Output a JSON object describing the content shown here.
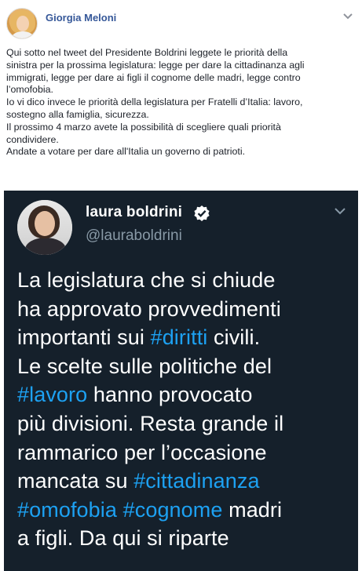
{
  "post": {
    "author": "Giorgia Meloni",
    "paragraph_lines": [
      "Qui sotto nel tweet del Presidente Boldrini leggete le priorità della",
      "sinistra per la prossima legislatura: legge per dare la cittadinanza agli",
      "immigrati, legge per dare ai figli il cognome delle madri, legge contro",
      "l’omofobia.",
      "Io vi dico invece le priorità della legislatura per Fratelli d’Italia: lavoro,",
      "sostegno alla famiglia, sicurezza.",
      "Il prossimo 4 marzo avete la possibilità di scegliere quali priorità",
      "condividere.",
      "Andate a votare per dare all'Italia un governo di patrioti."
    ]
  },
  "tweet": {
    "name": "laura boldrini",
    "handle": "@lauraboldrini",
    "lines": [
      [
        {
          "t": "La legislatura che si chiude"
        }
      ],
      [
        {
          "t": "ha approvato provvedimenti"
        }
      ],
      [
        {
          "t": "importanti sui "
        },
        {
          "t": "#diritti",
          "h": true
        },
        {
          "t": " civili."
        }
      ],
      [
        {
          "t": "Le scelte sulle politiche del"
        }
      ],
      [
        {
          "t": "#lavoro",
          "h": true
        },
        {
          "t": " hanno provocato"
        }
      ],
      [
        {
          "t": "più divisioni. Resta grande il"
        }
      ],
      [
        {
          "t": "rammarico per l’occasione"
        }
      ],
      [
        {
          "t": "mancata su "
        },
        {
          "t": "#cittadinanza",
          "h": true
        }
      ],
      [
        {
          "t": "#omofobia",
          "h": true
        },
        {
          "t": " "
        },
        {
          "t": "#cognome",
          "h": true
        },
        {
          "t": " madri"
        }
      ],
      [
        {
          "t": "a figli. Da qui si riparte"
        }
      ]
    ],
    "colors": {
      "background": "#15202b",
      "hashtag": "#1da1f2",
      "text": "#ffffff",
      "handle": "#8899a6"
    }
  },
  "icons": {
    "post_menu": "chevron-down-icon",
    "verified": "verified-badge-icon",
    "tweet_menu": "chevron-down-icon"
  }
}
